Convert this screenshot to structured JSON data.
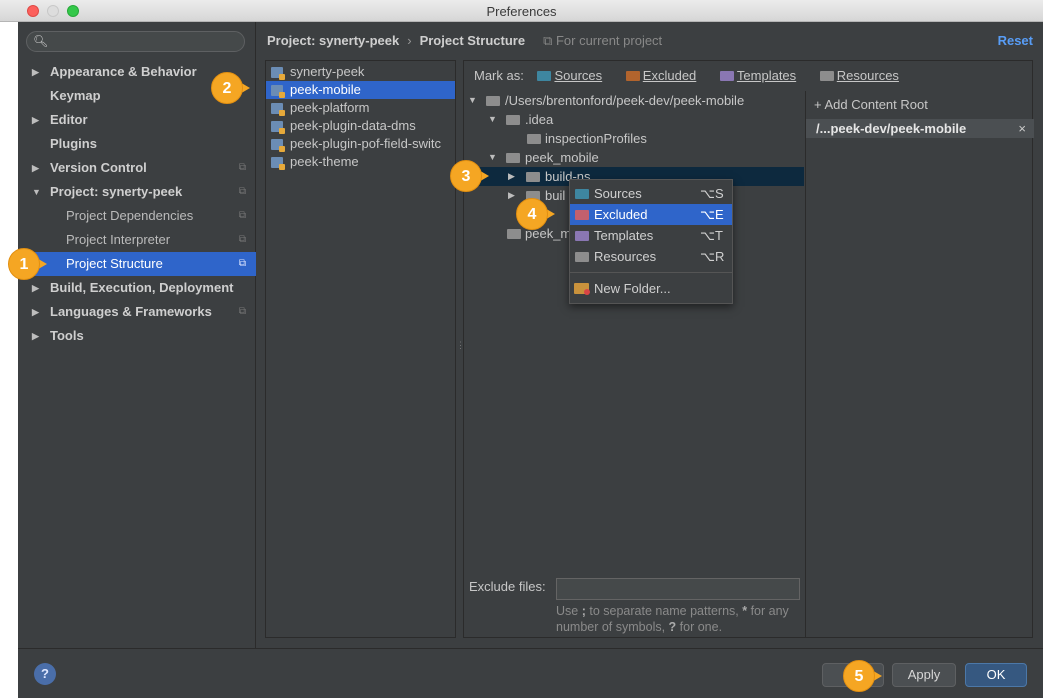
{
  "window": {
    "title": "Preferences"
  },
  "search": {
    "placeholder": ""
  },
  "nav": [
    {
      "label": "Appearance & Behavior",
      "arrow": "▶"
    },
    {
      "label": "Keymap",
      "arrow": ""
    },
    {
      "label": "Editor",
      "arrow": "▶"
    },
    {
      "label": "Plugins",
      "arrow": ""
    },
    {
      "label": "Version Control",
      "arrow": "▶"
    },
    {
      "label": "Project: synerty-peek",
      "arrow": "▼"
    },
    {
      "label": "Project Dependencies",
      "arrow": ""
    },
    {
      "label": "Project Interpreter",
      "arrow": ""
    },
    {
      "label": "Project Structure",
      "arrow": ""
    },
    {
      "label": "Build, Execution, Deployment",
      "arrow": "▶"
    },
    {
      "label": "Languages & Frameworks",
      "arrow": "▶"
    },
    {
      "label": "Tools",
      "arrow": "▶"
    }
  ],
  "breadcrumb": {
    "project": "Project: synerty-peek",
    "separator": "›",
    "page": "Project Structure",
    "scope": "For current project"
  },
  "reset_label": "Reset",
  "modules": [
    "synerty-peek",
    "peek-mobile",
    "peek-platform",
    "peek-plugin-data-dms",
    "peek-plugin-pof-field-switc",
    "peek-theme"
  ],
  "mark_as": {
    "label": "Mark as:",
    "sources": "Sources",
    "excluded": "Excluded",
    "templates": "Templates",
    "resources": "Resources"
  },
  "tree": [
    {
      "label": "/Users/brentonford/peek-dev/peek-mobile",
      "arrow": "▼"
    },
    {
      "label": ".idea",
      "arrow": "▼"
    },
    {
      "label": "inspectionProfiles",
      "arrow": ""
    },
    {
      "label": "peek_mobile",
      "arrow": "▼"
    },
    {
      "label": "build-ns",
      "arrow": "▶"
    },
    {
      "label": "buil",
      "arrow": "▶"
    },
    {
      "label": "peek_m",
      "arrow": ""
    }
  ],
  "roots": {
    "add_label": "+ Add Content Root",
    "item": "/...peek-dev/peek-mobile",
    "close": "×"
  },
  "exclude": {
    "label": "Exclude files:",
    "value": "",
    "hint_pre": "Use ",
    "hint_sep": ";",
    "hint_mid": " to separate name patterns, ",
    "hint_star": "*",
    "hint_mid2": " for any number of symbols, ",
    "hint_q": "?",
    "hint_end": " for one."
  },
  "menu": [
    {
      "label": "Sources",
      "shortcut": "⌥S"
    },
    {
      "label": "Excluded",
      "shortcut": "⌥E"
    },
    {
      "label": "Templates",
      "shortcut": "⌥T"
    },
    {
      "label": "Resources",
      "shortcut": "⌥R"
    },
    {
      "label": "New Folder...",
      "shortcut": ""
    }
  ],
  "buttons": {
    "help": "?",
    "cancel": "C",
    "apply": "Apply",
    "ok": "OK"
  },
  "callouts": [
    "1",
    "2",
    "3",
    "4",
    "5"
  ]
}
